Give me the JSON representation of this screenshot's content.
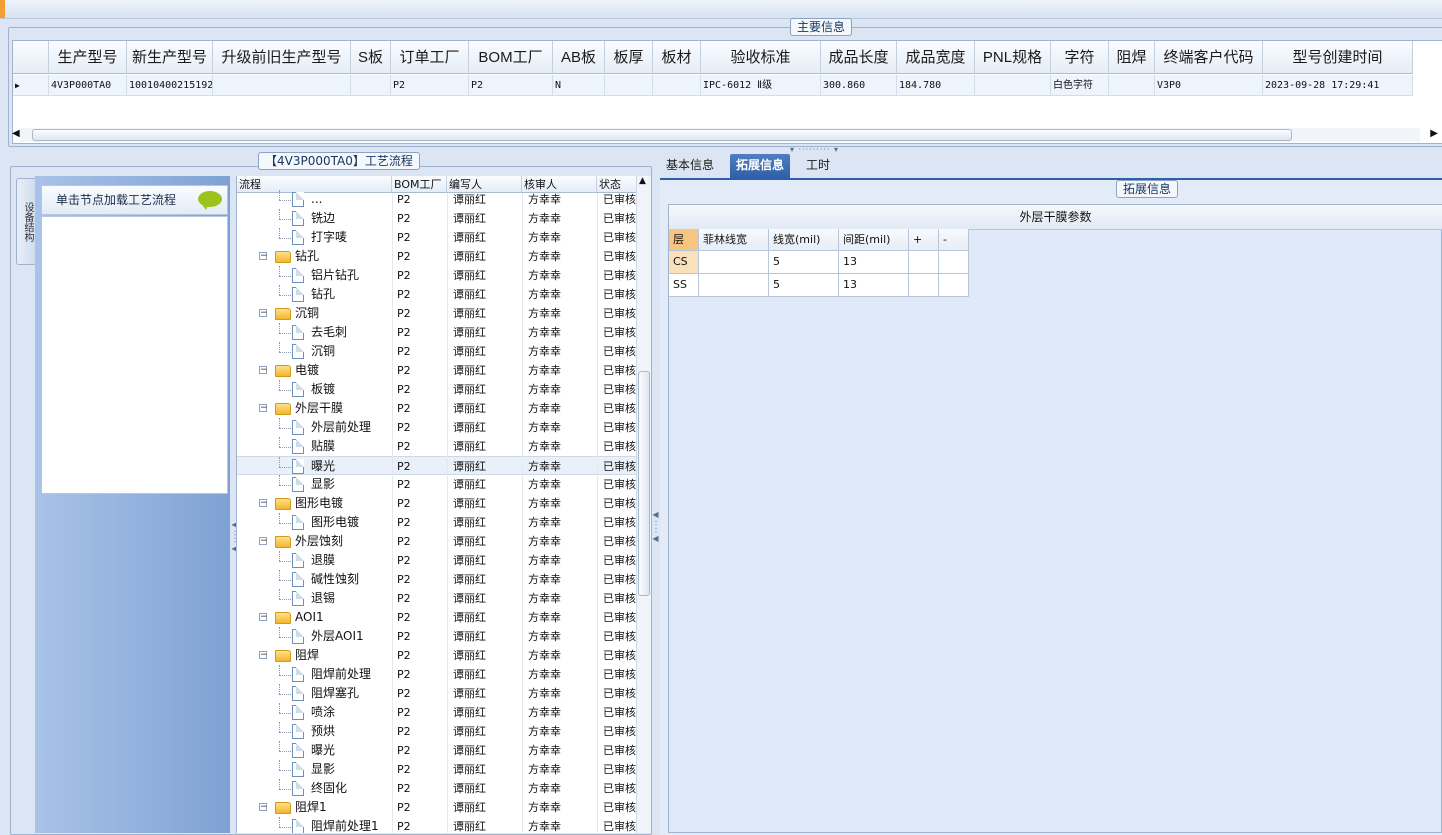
{
  "main_info": {
    "title": "主要信息",
    "columns": [
      "生产型号",
      "新生产型号",
      "升级前旧生产型号",
      "S板",
      "订单工厂",
      "BOM工厂",
      "AB板",
      "板厚",
      "板材",
      "验收标准",
      "成品长度",
      "成品宽度",
      "PNL规格",
      "字符",
      "阻焊",
      "终端客户代码",
      "型号创建时间"
    ],
    "row": [
      "4V3P000TA0",
      "10010400215192",
      "",
      "",
      "P2",
      "P2",
      "N",
      "",
      "",
      "IPC-6012 Ⅱ级",
      "300.860",
      "184.780",
      "",
      "白色字符",
      "",
      "V3P0",
      "2023-09-28 17:29:41"
    ]
  },
  "process": {
    "title": "【4V3P000TA0】工艺流程",
    "vertical_tab": "设备结构",
    "nav_header": "单击节点加载工艺流程",
    "columns": [
      "流程",
      "BOM工厂",
      "编写人",
      "核审人",
      "状态"
    ],
    "rows": [
      {
        "name": "...",
        "level": 2,
        "type": "doc",
        "bom": "P2",
        "writer": "谭丽红",
        "reviewer": "方幸幸",
        "status": "已审核"
      },
      {
        "name": "铣边",
        "level": 2,
        "type": "doc",
        "bom": "P2",
        "writer": "谭丽红",
        "reviewer": "方幸幸",
        "status": "已审核"
      },
      {
        "name": "打字唛",
        "level": 2,
        "type": "doc",
        "bom": "P2",
        "writer": "谭丽红",
        "reviewer": "方幸幸",
        "status": "已审核"
      },
      {
        "name": "钻孔",
        "level": 1,
        "type": "folder",
        "bom": "P2",
        "writer": "谭丽红",
        "reviewer": "方幸幸",
        "status": "已审核"
      },
      {
        "name": "铝片钻孔",
        "level": 2,
        "type": "doc",
        "bom": "P2",
        "writer": "谭丽红",
        "reviewer": "方幸幸",
        "status": "已审核"
      },
      {
        "name": "钻孔",
        "level": 2,
        "type": "doc",
        "bom": "P2",
        "writer": "谭丽红",
        "reviewer": "方幸幸",
        "status": "已审核"
      },
      {
        "name": "沉铜",
        "level": 1,
        "type": "folder",
        "bom": "P2",
        "writer": "谭丽红",
        "reviewer": "方幸幸",
        "status": "已审核"
      },
      {
        "name": "去毛刺",
        "level": 2,
        "type": "doc",
        "bom": "P2",
        "writer": "谭丽红",
        "reviewer": "方幸幸",
        "status": "已审核"
      },
      {
        "name": "沉铜",
        "level": 2,
        "type": "doc",
        "bom": "P2",
        "writer": "谭丽红",
        "reviewer": "方幸幸",
        "status": "已审核"
      },
      {
        "name": "电镀",
        "level": 1,
        "type": "folder",
        "bom": "P2",
        "writer": "谭丽红",
        "reviewer": "方幸幸",
        "status": "已审核"
      },
      {
        "name": "板镀",
        "level": 2,
        "type": "doc",
        "bom": "P2",
        "writer": "谭丽红",
        "reviewer": "方幸幸",
        "status": "已审核"
      },
      {
        "name": "外层干膜",
        "level": 1,
        "type": "folder",
        "bom": "P2",
        "writer": "谭丽红",
        "reviewer": "方幸幸",
        "status": "已审核"
      },
      {
        "name": "外层前处理",
        "level": 2,
        "type": "doc",
        "bom": "P2",
        "writer": "谭丽红",
        "reviewer": "方幸幸",
        "status": "已审核"
      },
      {
        "name": "贴膜",
        "level": 2,
        "type": "doc",
        "bom": "P2",
        "writer": "谭丽红",
        "reviewer": "方幸幸",
        "status": "已审核"
      },
      {
        "name": "曝光",
        "level": 2,
        "type": "doc",
        "bom": "P2",
        "writer": "谭丽红",
        "reviewer": "方幸幸",
        "status": "已审核",
        "selected": true
      },
      {
        "name": "显影",
        "level": 2,
        "type": "doc",
        "bom": "P2",
        "writer": "谭丽红",
        "reviewer": "方幸幸",
        "status": "已审核"
      },
      {
        "name": "图形电镀",
        "level": 1,
        "type": "folder",
        "bom": "P2",
        "writer": "谭丽红",
        "reviewer": "方幸幸",
        "status": "已审核"
      },
      {
        "name": "图形电镀",
        "level": 2,
        "type": "doc",
        "bom": "P2",
        "writer": "谭丽红",
        "reviewer": "方幸幸",
        "status": "已审核"
      },
      {
        "name": "外层蚀刻",
        "level": 1,
        "type": "folder",
        "bom": "P2",
        "writer": "谭丽红",
        "reviewer": "方幸幸",
        "status": "已审核"
      },
      {
        "name": "退膜",
        "level": 2,
        "type": "doc",
        "bom": "P2",
        "writer": "谭丽红",
        "reviewer": "方幸幸",
        "status": "已审核"
      },
      {
        "name": "碱性蚀刻",
        "level": 2,
        "type": "doc",
        "bom": "P2",
        "writer": "谭丽红",
        "reviewer": "方幸幸",
        "status": "已审核"
      },
      {
        "name": "退锡",
        "level": 2,
        "type": "doc",
        "bom": "P2",
        "writer": "谭丽红",
        "reviewer": "方幸幸",
        "status": "已审核"
      },
      {
        "name": "AOI1",
        "level": 1,
        "type": "folder",
        "bom": "P2",
        "writer": "谭丽红",
        "reviewer": "方幸幸",
        "status": "已审核"
      },
      {
        "name": "外层AOI1",
        "level": 2,
        "type": "doc",
        "bom": "P2",
        "writer": "谭丽红",
        "reviewer": "方幸幸",
        "status": "已审核"
      },
      {
        "name": "阻焊",
        "level": 1,
        "type": "folder",
        "bom": "P2",
        "writer": "谭丽红",
        "reviewer": "方幸幸",
        "status": "已审核"
      },
      {
        "name": "阻焊前处理",
        "level": 2,
        "type": "doc",
        "bom": "P2",
        "writer": "谭丽红",
        "reviewer": "方幸幸",
        "status": "已审核"
      },
      {
        "name": "阻焊塞孔",
        "level": 2,
        "type": "doc",
        "bom": "P2",
        "writer": "谭丽红",
        "reviewer": "方幸幸",
        "status": "已审核"
      },
      {
        "name": "喷涂",
        "level": 2,
        "type": "doc",
        "bom": "P2",
        "writer": "谭丽红",
        "reviewer": "方幸幸",
        "status": "已审核"
      },
      {
        "name": "预烘",
        "level": 2,
        "type": "doc",
        "bom": "P2",
        "writer": "谭丽红",
        "reviewer": "方幸幸",
        "status": "已审核"
      },
      {
        "name": "曝光",
        "level": 2,
        "type": "doc",
        "bom": "P2",
        "writer": "谭丽红",
        "reviewer": "方幸幸",
        "status": "已审核"
      },
      {
        "name": "显影",
        "level": 2,
        "type": "doc",
        "bom": "P2",
        "writer": "谭丽红",
        "reviewer": "方幸幸",
        "status": "已审核"
      },
      {
        "name": "终固化",
        "level": 2,
        "type": "doc",
        "bom": "P2",
        "writer": "谭丽红",
        "reviewer": "方幸幸",
        "status": "已审核"
      },
      {
        "name": "阻焊1",
        "level": 1,
        "type": "folder",
        "bom": "P2",
        "writer": "谭丽红",
        "reviewer": "方幸幸",
        "status": "已审核"
      },
      {
        "name": "阻焊前处理1",
        "level": 2,
        "type": "doc",
        "bom": "P2",
        "writer": "谭丽红",
        "reviewer": "方幸幸",
        "status": "已审核"
      }
    ]
  },
  "right": {
    "tabs": [
      "基本信息",
      "拓展信息",
      "工时"
    ],
    "active_tab": 1,
    "group_title": "拓展信息",
    "panel_title": "外层干膜参数",
    "columns": [
      "层",
      "菲林线宽",
      "线宽(mil)",
      "间距(mil)",
      "+",
      "-"
    ],
    "rows": [
      [
        "CS",
        "",
        "5",
        "13",
        "",
        ""
      ],
      [
        "SS",
        "",
        "5",
        "13",
        "",
        ""
      ]
    ]
  },
  "colors": {
    "accent": "#2e5fa8",
    "header_bg": "#e5edf7",
    "layer_highlight": "#f6c57f"
  }
}
